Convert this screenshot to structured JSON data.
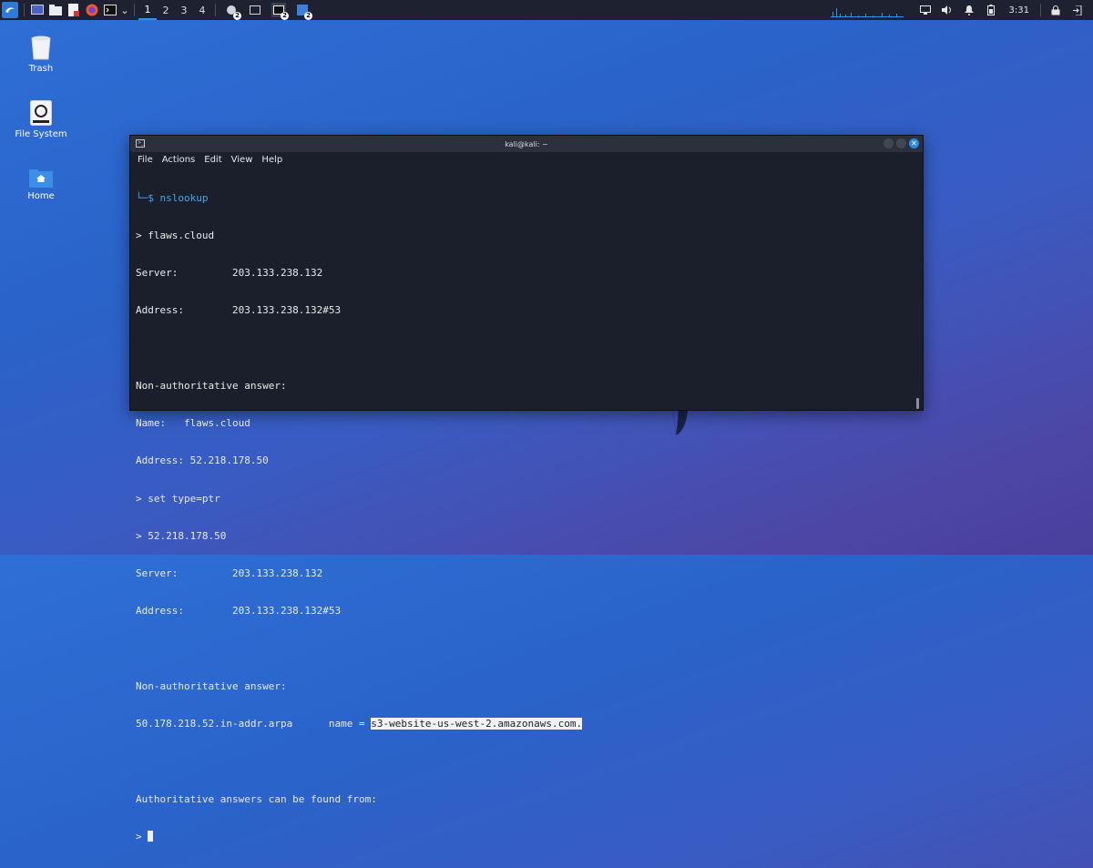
{
  "taskbar": {
    "workspaces": [
      "1",
      "2",
      "3",
      "4"
    ],
    "active_workspace": "1",
    "window_badges": [
      "2",
      "2",
      "2"
    ],
    "clock": "3:31",
    "accent": "#3d8ee8"
  },
  "desktop": {
    "icons": [
      {
        "label": "Trash",
        "icon": "trash-icon"
      },
      {
        "label": "File System",
        "icon": "drive-icon"
      },
      {
        "label": "Home",
        "icon": "home-folder-icon"
      }
    ]
  },
  "terminal": {
    "title": "kali@kali: ~",
    "menu": [
      "File",
      "Actions",
      "Edit",
      "View",
      "Help"
    ],
    "lines": [
      {
        "prefix": "└─$ ",
        "text": "nslookup",
        "type": "prompt"
      },
      {
        "text": "> flaws.cloud"
      },
      {
        "text": "Server:         203.133.238.132"
      },
      {
        "text": "Address:        203.133.238.132#53"
      },
      {
        "text": ""
      },
      {
        "text": "Non-authoritative answer:"
      },
      {
        "text": "Name:   flaws.cloud"
      },
      {
        "text": "Address: 52.218.178.50"
      },
      {
        "text": "> set type=ptr"
      },
      {
        "text": "> 52.218.178.50"
      },
      {
        "text": "Server:         203.133.238.132"
      },
      {
        "text": "Address:        203.133.238.132#53"
      },
      {
        "text": ""
      },
      {
        "text": "Non-authoritative answer:"
      },
      {
        "text": "50.178.218.52.in-addr.arpa      name = ",
        "highlight": "s3-website-us-west-2.amazonaws.com."
      },
      {
        "text": ""
      },
      {
        "text": "Authoritative answers can be found from:"
      },
      {
        "text": "> ",
        "cursor": true
      }
    ],
    "colors": {
      "background": "#1b1f2b",
      "prompt": "#4aa3f0",
      "text": "#e8eaee"
    }
  }
}
